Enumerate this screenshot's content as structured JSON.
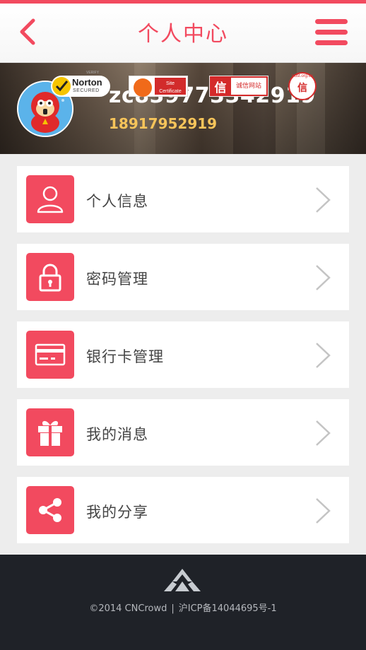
{
  "header": {
    "title": "个人中心",
    "back_icon": "chevron-left-icon",
    "menu_icon": "hamburger-menu-icon"
  },
  "profile": {
    "username": "zc839773342919",
    "phone": "18917952919"
  },
  "menu_items": [
    {
      "label": "个人信息",
      "icon": "user-icon"
    },
    {
      "label": "密码管理",
      "icon": "lock-icon"
    },
    {
      "label": "银行卡管理",
      "icon": "credit-card-icon"
    },
    {
      "label": "我的消息",
      "icon": "gift-icon"
    },
    {
      "label": "我的分享",
      "icon": "share-icon"
    }
  ],
  "footer": {
    "copyright": "©2014 CNCrowd",
    "separator": "|",
    "icp": "沪ICP备14044695号-1",
    "badges": {
      "norton_name": "Norton",
      "norton_sub": "SECURED",
      "norton_verify": "VERIFY",
      "site_cert": "Site Certificate",
      "chengxin_char": "信",
      "chengxin_text": "诚信网站",
      "trust_char": "信",
      "trust_url": "trust.org.cn"
    }
  },
  "colors": {
    "accent": "#f24a5f",
    "phone": "#f6c45a",
    "footer_bg": "#1f2228",
    "page_bg": "#ededed"
  }
}
